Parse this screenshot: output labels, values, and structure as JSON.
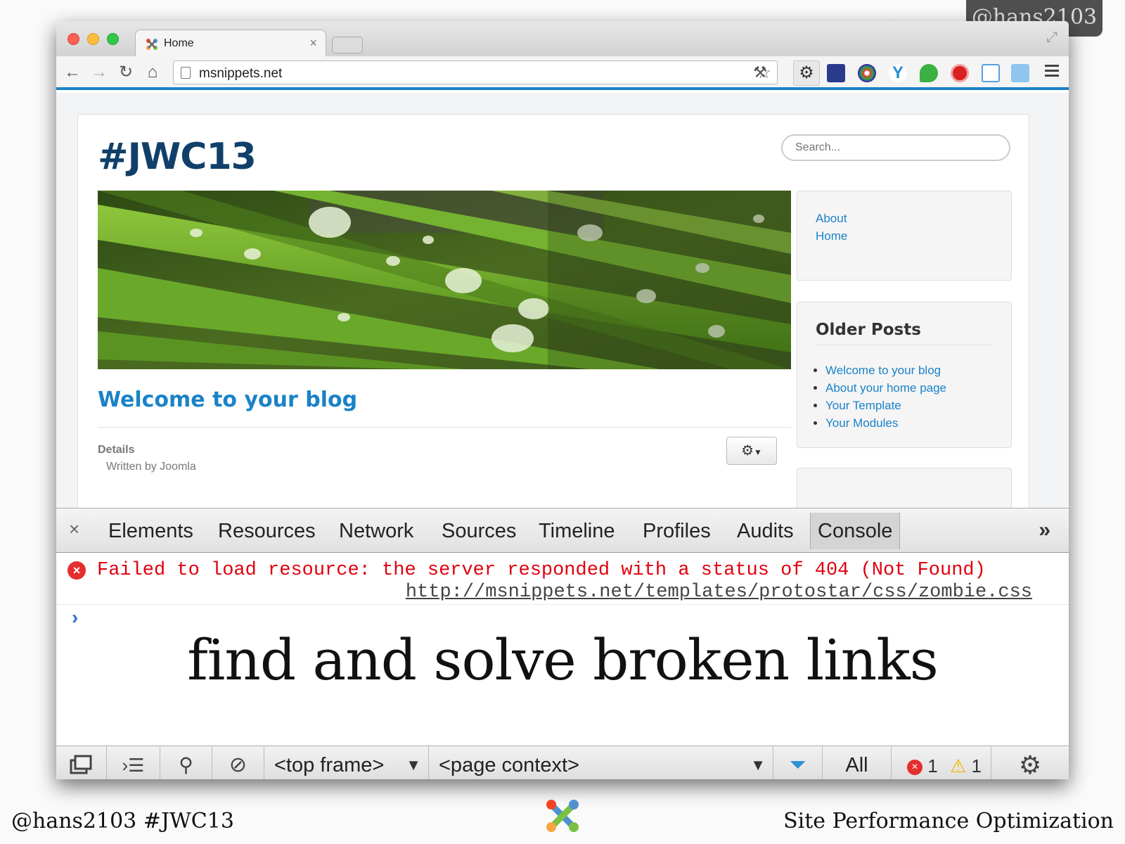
{
  "slide": {
    "handle_top": "@hans2103",
    "footer_left": "@hans2103 #JWC13",
    "footer_right": "Site Performance Optimization",
    "caption": "find and solve broken links"
  },
  "browser": {
    "tab_title": "Home",
    "tab_close": "×",
    "url": "msnippets.net",
    "accent_color": "#1a82c8"
  },
  "site": {
    "title": "#JWC13",
    "search_placeholder": "Search...",
    "article_title": "Welcome to your blog",
    "details_label": "Details",
    "details_author": "Written by Joomla",
    "menu": [
      "About",
      "Home"
    ],
    "older_posts_heading": "Older Posts",
    "older_posts": [
      "Welcome to your blog",
      "About your home page",
      "Your Template",
      "Your Modules"
    ]
  },
  "devtools": {
    "close": "×",
    "tabs": [
      "Elements",
      "Resources",
      "Network",
      "Sources",
      "Timeline",
      "Profiles",
      "Audits",
      "Console"
    ],
    "active_tab": "Console",
    "more": "»",
    "error_message": "Failed to load resource: the server responded with a status of 404 (Not Found)",
    "error_url": "http://msnippets.net/templates/protostar/css/zombie.css",
    "prompt": "›",
    "frame_select": "<top frame>",
    "context_select": "<page context>",
    "filter_all": "All",
    "error_count": "1",
    "warning_count": "1",
    "error_color": "#e0000e"
  }
}
